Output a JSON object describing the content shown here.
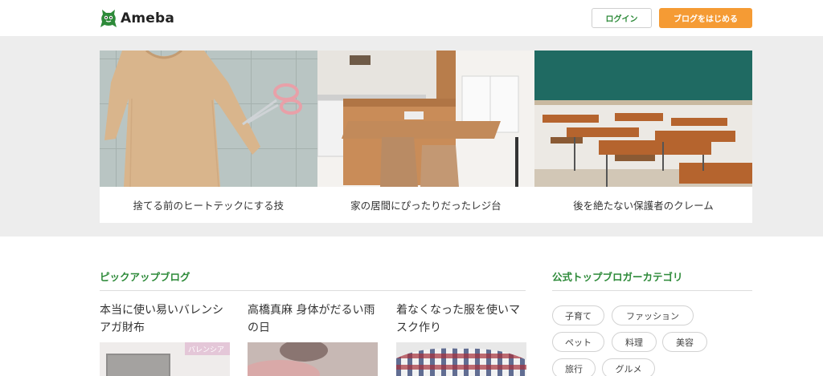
{
  "header": {
    "logo_text": "Ameba",
    "login_label": "ログイン",
    "start_label": "ブログをはじめる",
    "accent_color": "#f59b34",
    "brand_color": "#2d8a39"
  },
  "hero": {
    "cards": [
      {
        "caption": "捨てる前のヒートテックにする技"
      },
      {
        "caption": "家の居間にぴったりだったレジ台"
      },
      {
        "caption": "後を絶たない保護者のクレーム"
      }
    ]
  },
  "pickup": {
    "title": "ピックアップブログ",
    "items": [
      {
        "title": "本当に使い易いバレンシアガ財布",
        "thumb_label": "バレンシア"
      },
      {
        "title": "高橋真麻 身体がだるい雨の日"
      },
      {
        "title": "着なくなった服を使いマスク作り"
      }
    ]
  },
  "categories": {
    "title": "公式トップブロガーカテゴリ",
    "tags": [
      "子育て",
      "ファッション",
      "ペット",
      "料理",
      "美容",
      "旅行",
      "グルメ"
    ]
  }
}
